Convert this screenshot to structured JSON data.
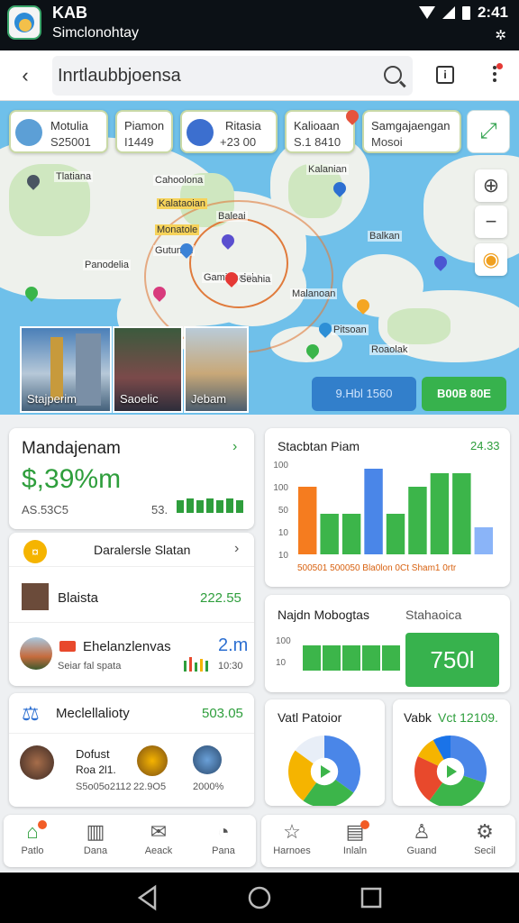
{
  "status_bar": {
    "app_title": "KAB",
    "app_subtitle": "Simclonohtay",
    "time": "2:41"
  },
  "search": {
    "query": "Inrtlaubbjoensa"
  },
  "map": {
    "chips": [
      {
        "name": "Motulia",
        "value": "S25001"
      },
      {
        "name": "Piamon",
        "value": "I1449"
      },
      {
        "name": "Ritasia",
        "value": "+23 00"
      },
      {
        "name": "Kalioaan",
        "value": "S.1 8410"
      },
      {
        "name": "Samgajaengan",
        "value": "Mosoi"
      }
    ],
    "labels": [
      "Tlatiana",
      "Kalanian",
      "Cahoolona",
      "Kalataoian",
      "Baleai",
      "Monatole",
      "Balkan",
      "Gutunah",
      "Panodelia",
      "Gamionalol",
      "Seahia",
      "Malanoan",
      "Pitsoan",
      "Roaolak"
    ],
    "thumbs": [
      {
        "label": "Stajperim"
      },
      {
        "label": "Saoelic"
      },
      {
        "label": "Jebam"
      }
    ],
    "stat_blue": "9.Hbl 1560",
    "stat_green": "B00B 80E"
  },
  "summary_card": {
    "title": "Mandajenam",
    "amount": "$,39%m",
    "sub_left": "AS.53C5",
    "sub_right": "53."
  },
  "station_list": {
    "header": "Daralersle Slatan",
    "rows": [
      {
        "name": "Blaista",
        "value": "222.55"
      },
      {
        "name": "Ehelanzlenvas",
        "sub": "Seiar fal spata",
        "value": "2.m",
        "value2": "10:30"
      }
    ]
  },
  "reliability_card": {
    "title": "Meclellalioty",
    "value": "503.05",
    "items": [
      {
        "title": "Dofust",
        "v1": "Roa 2l1.",
        "v2": "S5o05o2112"
      },
      {
        "v1": "22.9O5"
      },
      {
        "v1": "2000%"
      }
    ]
  },
  "bar_chart": {
    "title": "Stacbtan Piam",
    "value": "24.33"
  },
  "chart_data": [
    {
      "type": "bar",
      "title": "Stacbtan Piam",
      "y_ticks": [
        "100",
        "100",
        "50",
        "10",
        "10"
      ],
      "x_labels": "500501 500050 Bla0lon 0Ct Sham1 0rtr",
      "values": [
        75,
        45,
        45,
        95,
        45,
        75,
        90,
        90,
        30
      ],
      "colors": [
        "#f57c1f",
        "#3cb54a",
        "#3cb54a",
        "#4a86e8",
        "#3cb54a",
        "#3cb54a",
        "#3cb54a",
        "#3cb54a",
        "#8ab4f8"
      ]
    },
    {
      "type": "bar",
      "title": "Najdn Mobogtas",
      "y_ticks": [
        "100",
        "10"
      ],
      "values": [
        1,
        1,
        1,
        1,
        1
      ],
      "colors": [
        "#3cb54a"
      ]
    },
    {
      "type": "pie",
      "title": "Vatl Patoior",
      "values": [
        35,
        25,
        25,
        15
      ],
      "colors": [
        "#4a86e8",
        "#3cb54a",
        "#f5b400",
        "#e8eef7"
      ]
    },
    {
      "type": "pie",
      "title": "Vabk",
      "values": [
        30,
        30,
        22,
        10,
        8
      ],
      "colors": [
        "#4a86e8",
        "#3cb54a",
        "#e8492c",
        "#f5b400",
        "#1a73e8"
      ]
    }
  ],
  "najdn_card": {
    "title": "Najdn Mobogtas",
    "right_label": "Stahaoica",
    "big_value": "750l"
  },
  "pie1_card": {
    "title": "Vatl Patoior"
  },
  "pie2_card": {
    "title": "Vabk",
    "value": "Vct 12109."
  },
  "bottom_nav_left": [
    {
      "label": "Patlo",
      "icon": "home-icon"
    },
    {
      "label": "Dana",
      "icon": "chart-icon"
    },
    {
      "label": "Aeack",
      "icon": "mail-icon"
    },
    {
      "label": "Pana",
      "icon": "chat-icon"
    }
  ],
  "bottom_nav_right": [
    {
      "label": "Harnoes",
      "icon": "star-icon"
    },
    {
      "label": "Inlaln",
      "icon": "inbox-icon"
    },
    {
      "label": "Guand",
      "icon": "person-icon"
    },
    {
      "label": "Secil",
      "icon": "gear-icon"
    }
  ]
}
